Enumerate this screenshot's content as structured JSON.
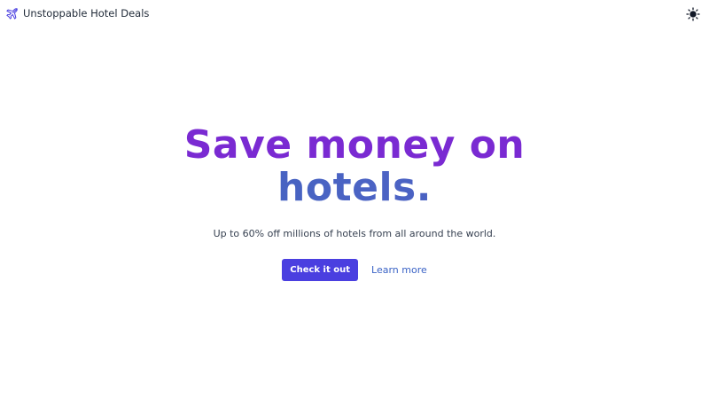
{
  "header": {
    "brand_name": "Unstoppable Hotel Deals",
    "brand_icon": "airplane-icon",
    "theme_icon": "sun-icon"
  },
  "hero": {
    "headline_line1": "Save money on",
    "headline_line2": "hotels.",
    "subtitle": "Up to 60% off millions of hotels from all around the world.",
    "primary_button": "Check it out",
    "secondary_link": "Learn more"
  },
  "colors": {
    "accent": "#4a3fe0",
    "headline_purple": "#7a2ad2",
    "headline_blue": "#3b62bd",
    "link": "#3b63c6"
  }
}
